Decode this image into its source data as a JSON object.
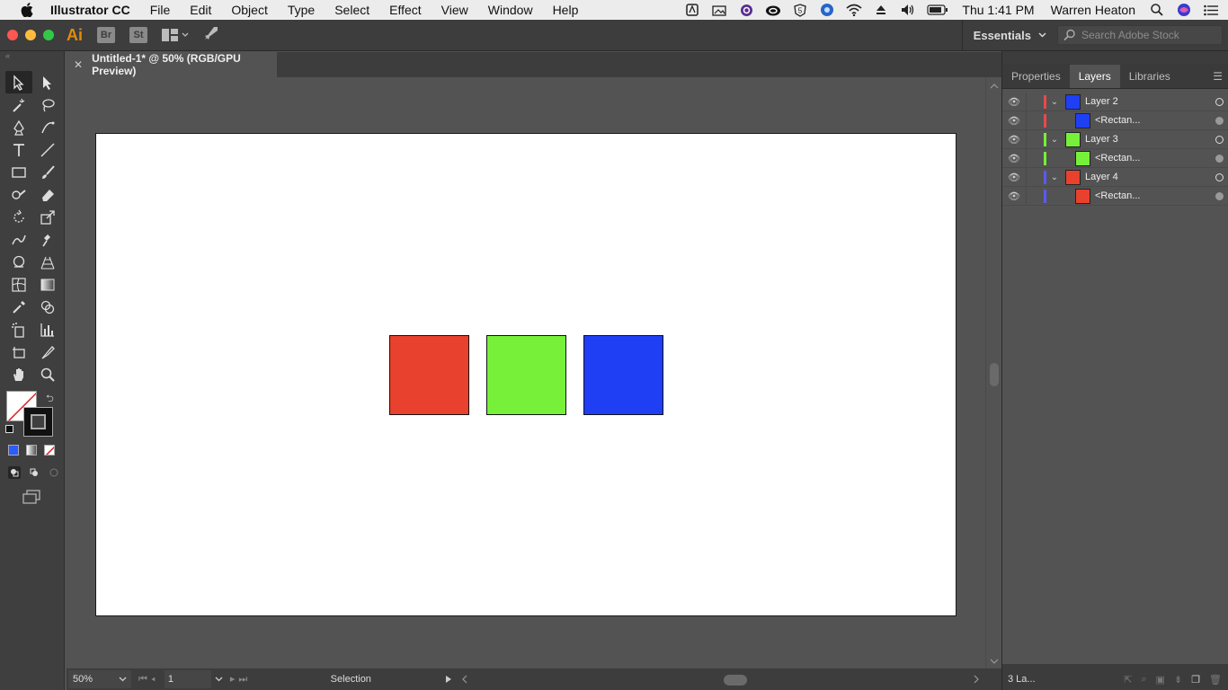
{
  "menubar": {
    "app_name": "Illustrator CC",
    "items": [
      "File",
      "Edit",
      "Object",
      "Type",
      "Select",
      "Effect",
      "View",
      "Window",
      "Help"
    ],
    "clock": "Thu 1:41 PM",
    "user": "Warren Heaton"
  },
  "appbar": {
    "logo": "Ai",
    "bridge_label": "Br",
    "stock_label": "St",
    "workspace": "Essentials",
    "search_placeholder": "Search Adobe Stock"
  },
  "document": {
    "tab_title": "Untitled-1* @ 50% (RGB/GPU Preview)"
  },
  "artwork": {
    "shapes": [
      {
        "name": "red-rectangle",
        "color": "#e8412d"
      },
      {
        "name": "green-rectangle",
        "color": "#77f03a"
      },
      {
        "name": "blue-rectangle",
        "color": "#1f3ff5"
      }
    ]
  },
  "statusbar": {
    "zoom": "50%",
    "page": "1",
    "current_tool": "Selection"
  },
  "panel": {
    "tabs": [
      "Properties",
      "Layers",
      "Libraries"
    ],
    "active_tab": "Layers",
    "layers": [
      {
        "name": "Layer 2",
        "color": "#1f3ff5",
        "bar": "#e84a4a",
        "child": "<Rectan..."
      },
      {
        "name": "Layer 3",
        "color": "#77f03a",
        "bar": "#77f03a",
        "child": "<Rectan..."
      },
      {
        "name": "Layer 4",
        "color": "#e8412d",
        "bar": "#5a5aff",
        "child": "<Rectan..."
      }
    ],
    "footer": "3 La..."
  }
}
